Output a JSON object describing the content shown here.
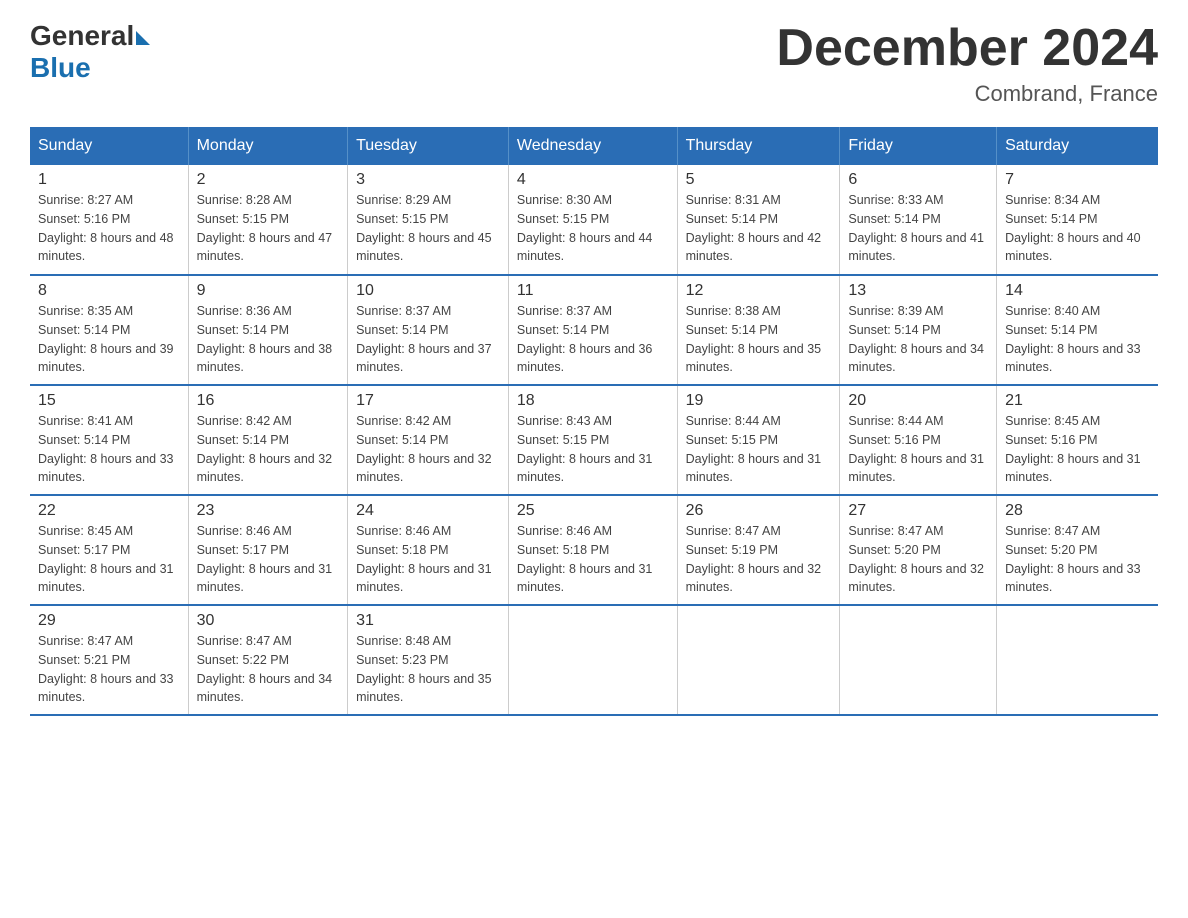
{
  "header": {
    "logo_general": "General",
    "logo_blue": "Blue",
    "month_title": "December 2024",
    "location": "Combrand, France"
  },
  "days_of_week": [
    "Sunday",
    "Monday",
    "Tuesday",
    "Wednesday",
    "Thursday",
    "Friday",
    "Saturday"
  ],
  "weeks": [
    [
      {
        "day": "1",
        "sunrise": "8:27 AM",
        "sunset": "5:16 PM",
        "daylight": "8 hours and 48 minutes."
      },
      {
        "day": "2",
        "sunrise": "8:28 AM",
        "sunset": "5:15 PM",
        "daylight": "8 hours and 47 minutes."
      },
      {
        "day": "3",
        "sunrise": "8:29 AM",
        "sunset": "5:15 PM",
        "daylight": "8 hours and 45 minutes."
      },
      {
        "day": "4",
        "sunrise": "8:30 AM",
        "sunset": "5:15 PM",
        "daylight": "8 hours and 44 minutes."
      },
      {
        "day": "5",
        "sunrise": "8:31 AM",
        "sunset": "5:14 PM",
        "daylight": "8 hours and 42 minutes."
      },
      {
        "day": "6",
        "sunrise": "8:33 AM",
        "sunset": "5:14 PM",
        "daylight": "8 hours and 41 minutes."
      },
      {
        "day": "7",
        "sunrise": "8:34 AM",
        "sunset": "5:14 PM",
        "daylight": "8 hours and 40 minutes."
      }
    ],
    [
      {
        "day": "8",
        "sunrise": "8:35 AM",
        "sunset": "5:14 PM",
        "daylight": "8 hours and 39 minutes."
      },
      {
        "day": "9",
        "sunrise": "8:36 AM",
        "sunset": "5:14 PM",
        "daylight": "8 hours and 38 minutes."
      },
      {
        "day": "10",
        "sunrise": "8:37 AM",
        "sunset": "5:14 PM",
        "daylight": "8 hours and 37 minutes."
      },
      {
        "day": "11",
        "sunrise": "8:37 AM",
        "sunset": "5:14 PM",
        "daylight": "8 hours and 36 minutes."
      },
      {
        "day": "12",
        "sunrise": "8:38 AM",
        "sunset": "5:14 PM",
        "daylight": "8 hours and 35 minutes."
      },
      {
        "day": "13",
        "sunrise": "8:39 AM",
        "sunset": "5:14 PM",
        "daylight": "8 hours and 34 minutes."
      },
      {
        "day": "14",
        "sunrise": "8:40 AM",
        "sunset": "5:14 PM",
        "daylight": "8 hours and 33 minutes."
      }
    ],
    [
      {
        "day": "15",
        "sunrise": "8:41 AM",
        "sunset": "5:14 PM",
        "daylight": "8 hours and 33 minutes."
      },
      {
        "day": "16",
        "sunrise": "8:42 AM",
        "sunset": "5:14 PM",
        "daylight": "8 hours and 32 minutes."
      },
      {
        "day": "17",
        "sunrise": "8:42 AM",
        "sunset": "5:14 PM",
        "daylight": "8 hours and 32 minutes."
      },
      {
        "day": "18",
        "sunrise": "8:43 AM",
        "sunset": "5:15 PM",
        "daylight": "8 hours and 31 minutes."
      },
      {
        "day": "19",
        "sunrise": "8:44 AM",
        "sunset": "5:15 PM",
        "daylight": "8 hours and 31 minutes."
      },
      {
        "day": "20",
        "sunrise": "8:44 AM",
        "sunset": "5:16 PM",
        "daylight": "8 hours and 31 minutes."
      },
      {
        "day": "21",
        "sunrise": "8:45 AM",
        "sunset": "5:16 PM",
        "daylight": "8 hours and 31 minutes."
      }
    ],
    [
      {
        "day": "22",
        "sunrise": "8:45 AM",
        "sunset": "5:17 PM",
        "daylight": "8 hours and 31 minutes."
      },
      {
        "day": "23",
        "sunrise": "8:46 AM",
        "sunset": "5:17 PM",
        "daylight": "8 hours and 31 minutes."
      },
      {
        "day": "24",
        "sunrise": "8:46 AM",
        "sunset": "5:18 PM",
        "daylight": "8 hours and 31 minutes."
      },
      {
        "day": "25",
        "sunrise": "8:46 AM",
        "sunset": "5:18 PM",
        "daylight": "8 hours and 31 minutes."
      },
      {
        "day": "26",
        "sunrise": "8:47 AM",
        "sunset": "5:19 PM",
        "daylight": "8 hours and 32 minutes."
      },
      {
        "day": "27",
        "sunrise": "8:47 AM",
        "sunset": "5:20 PM",
        "daylight": "8 hours and 32 minutes."
      },
      {
        "day": "28",
        "sunrise": "8:47 AM",
        "sunset": "5:20 PM",
        "daylight": "8 hours and 33 minutes."
      }
    ],
    [
      {
        "day": "29",
        "sunrise": "8:47 AM",
        "sunset": "5:21 PM",
        "daylight": "8 hours and 33 minutes."
      },
      {
        "day": "30",
        "sunrise": "8:47 AM",
        "sunset": "5:22 PM",
        "daylight": "8 hours and 34 minutes."
      },
      {
        "day": "31",
        "sunrise": "8:48 AM",
        "sunset": "5:23 PM",
        "daylight": "8 hours and 35 minutes."
      },
      null,
      null,
      null,
      null
    ]
  ],
  "labels": {
    "sunrise": "Sunrise:",
    "sunset": "Sunset:",
    "daylight": "Daylight:"
  }
}
